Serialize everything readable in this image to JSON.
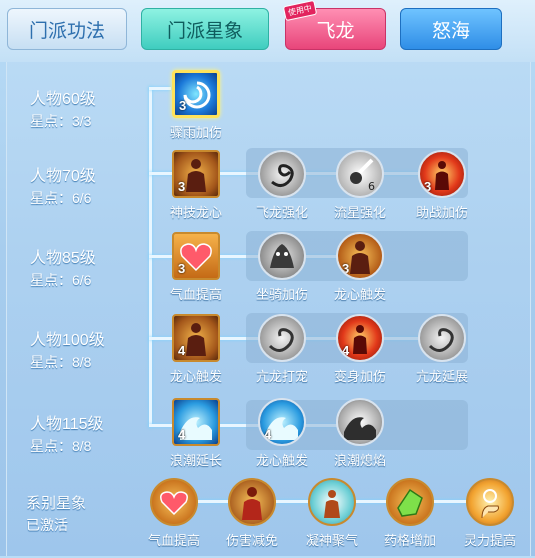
{
  "tabs": [
    {
      "label": "门派功法"
    },
    {
      "label": "门派星象"
    },
    {
      "label": "飞龙",
      "badge": "使用中"
    },
    {
      "label": "怒海"
    }
  ],
  "rows": [
    {
      "level": "人物60级",
      "stars": "星点：3/3",
      "nodes": [
        {
          "label": "骤雨加伤",
          "lvl": "3",
          "icon": "vortex-icon"
        }
      ]
    },
    {
      "level": "人物70级",
      "stars": "星点：6/6",
      "nodes": [
        {
          "label": "神技龙心",
          "lvl": "3",
          "icon": "warrior-icon"
        },
        {
          "label": "飞龙强化",
          "lvl": "",
          "icon": "dragon-icon"
        },
        {
          "label": "流星强化",
          "lvl": "6",
          "icon": "meteor-icon"
        },
        {
          "label": "助战加伤",
          "lvl": "3",
          "icon": "body-burst-icon"
        }
      ]
    },
    {
      "level": "人物85级",
      "stars": "星点：6/6",
      "nodes": [
        {
          "label": "气血提高",
          "lvl": "3",
          "icon": "heart-icon"
        },
        {
          "label": "坐骑加伤",
          "lvl": "",
          "icon": "beast-icon"
        },
        {
          "label": "龙心触发",
          "lvl": "3",
          "icon": "warrior-icon"
        }
      ]
    },
    {
      "level": "人物100级",
      "stars": "星点：8/8",
      "nodes": [
        {
          "label": "龙心触发",
          "lvl": "4",
          "icon": "warrior-icon"
        },
        {
          "label": "亢龙打宠",
          "lvl": "",
          "icon": "dragon-icon"
        },
        {
          "label": "变身加伤",
          "lvl": "4",
          "icon": "body-burst-icon"
        },
        {
          "label": "亢龙延展",
          "lvl": "",
          "icon": "dragon-icon"
        }
      ]
    },
    {
      "level": "人物115级",
      "stars": "星点：8/8",
      "nodes": [
        {
          "label": "浪潮延长",
          "lvl": "4",
          "icon": "wave-icon"
        },
        {
          "label": "龙心触发",
          "lvl": "4",
          "icon": "wave-icon"
        },
        {
          "label": "浪潮熄焰",
          "lvl": "",
          "icon": "wave-gray-icon"
        }
      ]
    }
  ],
  "system": {
    "title": "系别星象",
    "status": "已激活",
    "nodes": [
      {
        "label": "气血提高",
        "icon": "heart-icon"
      },
      {
        "label": "伤害减免",
        "icon": "shield-man-icon"
      },
      {
        "label": "凝神聚气",
        "icon": "focus-icon"
      },
      {
        "label": "药格增加",
        "icon": "gem-icon"
      },
      {
        "label": "灵力提高",
        "icon": "hand-sun-icon"
      }
    ]
  }
}
